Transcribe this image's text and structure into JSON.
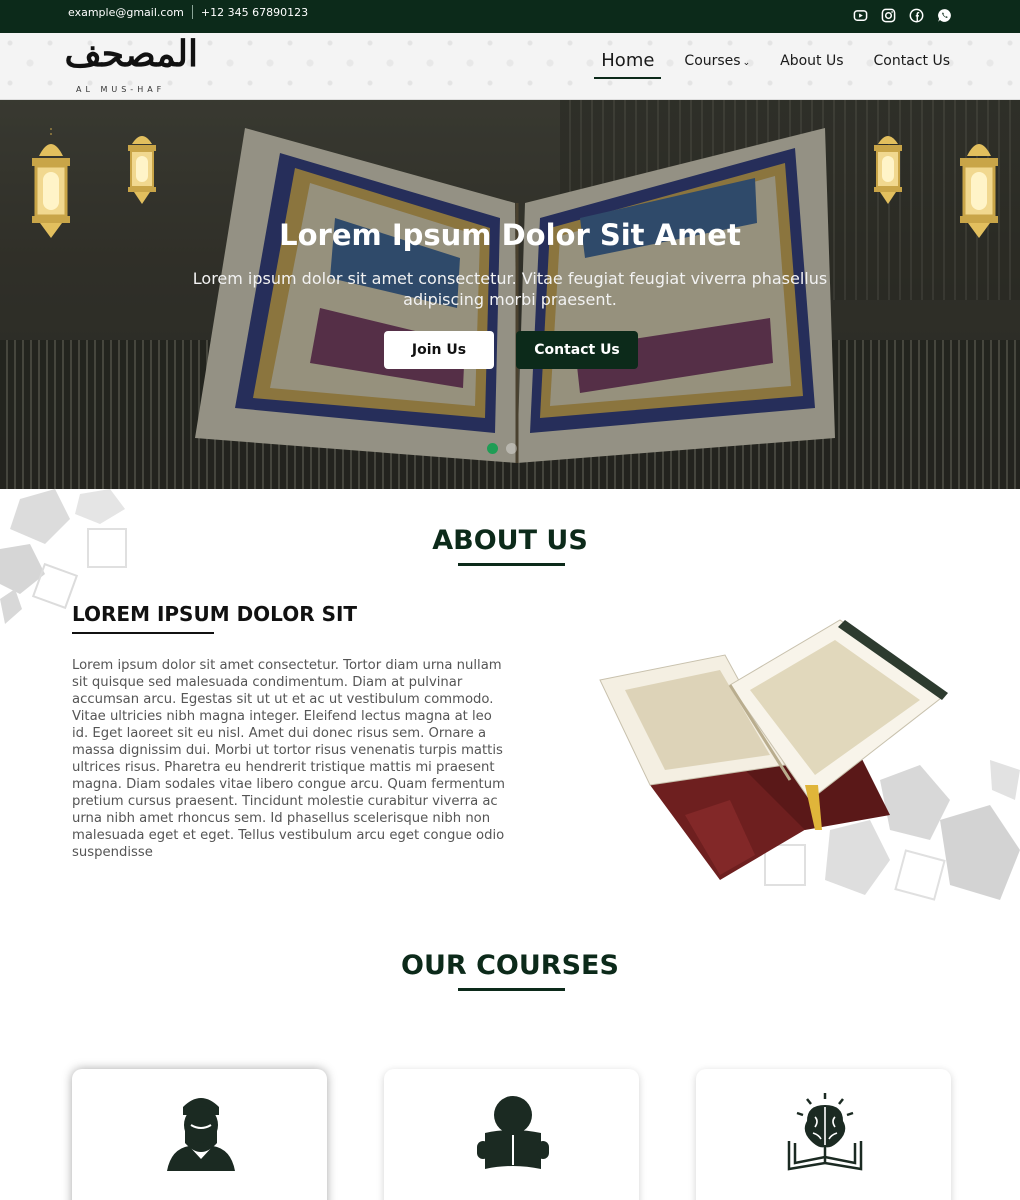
{
  "topbar": {
    "email": "example@gmail.com",
    "phone": "+12 345 67890123",
    "social": [
      "youtube-icon",
      "instagram-icon",
      "facebook-icon",
      "whatsapp-icon"
    ]
  },
  "logo": {
    "arabic": "المصحف",
    "latin": "AL MUS-HAF"
  },
  "nav": {
    "home": "Home",
    "courses": "Courses",
    "about": "About Us",
    "contact": "Contact Us"
  },
  "hero": {
    "title": "Lorem Ipsum Dolor Sit Amet",
    "subtitle": "Lorem ipsum dolor sit amet consectetur. Vitae feugiat feugiat viverra phasellus adipiscing morbi praesent.",
    "join_label": "Join Us",
    "contact_label": "Contact Us",
    "slides": 2,
    "active_slide": 1
  },
  "about": {
    "title": "ABOUT US",
    "heading": "LOREM IPSUM DOLOR SIT",
    "body": "Lorem ipsum dolor sit amet consectetur. Tortor diam urna nullam sit quisque sed malesuada condimentum. Diam at pulvinar accumsan arcu. Egestas sit ut ut et ac ut vestibulum commodo. Vitae ultricies nibh magna integer. Eleifend lectus magna at leo id. Eget laoreet sit eu nisl. Amet dui donec risus sem. Ornare a massa dignissim dui. Morbi ut tortor risus venenatis turpis mattis ultrices risus. Pharetra eu hendrerit tristique mattis mi praesent magna. Diam sodales vitae libero congue arcu. Quam fermentum pretium cursus praesent. Tincidunt molestie curabitur viverra ac urna nibh amet rhoncus sem. Id phasellus scelerisque nibh non malesuada eget et eget. Tellus vestibulum arcu eget congue odio suspendisse"
  },
  "courses": {
    "title": "OUR COURSES",
    "cards": [
      {
        "icon": "teacher-icon"
      },
      {
        "icon": "reader-icon"
      },
      {
        "icon": "brain-book-icon"
      }
    ]
  },
  "colors": {
    "primary": "#0c2a1a",
    "accent_gold": "#c9a548",
    "active_dot": "#1f9d55"
  }
}
